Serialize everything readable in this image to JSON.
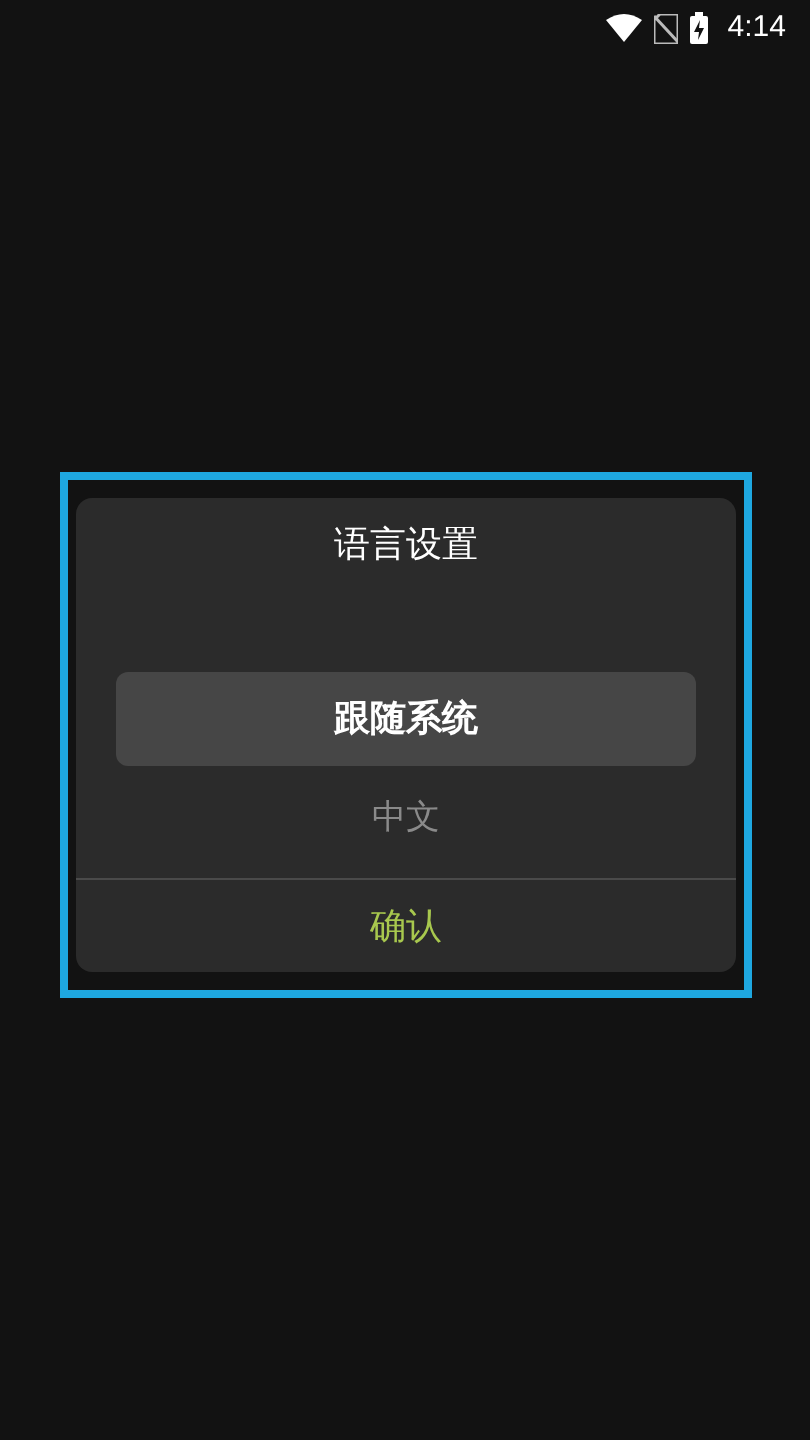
{
  "status_bar": {
    "time": "4:14"
  },
  "dialog": {
    "title": "语言设置",
    "options": [
      {
        "label": "跟随系统",
        "selected": true
      },
      {
        "label": "中文",
        "selected": false
      }
    ],
    "confirm_button": "确认"
  }
}
